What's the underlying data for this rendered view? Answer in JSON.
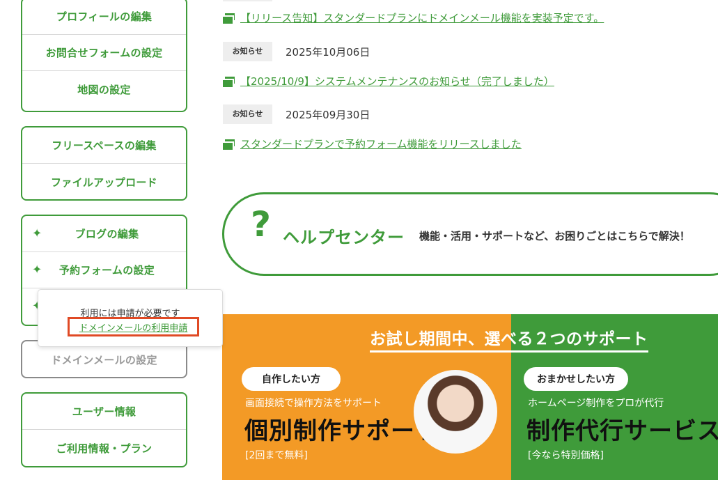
{
  "sidebar": {
    "group1": [
      "プロフィールの編集",
      "お問合せフォームの設定",
      "地図の設定"
    ],
    "group2": [
      "フリースペースの編集",
      "ファイルアップロード"
    ],
    "group3": [
      "ブログの編集",
      "予約フォームの設定",
      ""
    ],
    "spark": "✦",
    "domain_settings": "ドメインメールの設定",
    "group5": [
      "ユーザー情報",
      "ご利用情報・プラン"
    ]
  },
  "tooltip": {
    "text": "利用には申請が必要です",
    "link": "ドメインメールの利用申請"
  },
  "news": [
    {
      "title": "【リリース告知】スタンダードプランにドメインメール機能を実装予定です。"
    },
    {
      "badge": "お知らせ",
      "date": "2025年10月06日",
      "title": "【2025/10/9】システムメンテナンスのお知らせ（完了しました）"
    },
    {
      "badge": "お知らせ",
      "date": "2025年09月30日",
      "title": "スタンダードプランで予約フォーム機能をリリースしました"
    }
  ],
  "help": {
    "icon": "?",
    "title": "ヘルプセンター",
    "description": "機能・活用・サポートなど、お困りごとはこちらで解決！"
  },
  "support": {
    "heading": "お試し期間中、選べる２つのサポート",
    "left": {
      "pill": "自作したい方",
      "sub": "画面接続で操作方法をサポート",
      "title": "個別制作サポート",
      "note": "[2回まで無料]"
    },
    "right": {
      "pill": "おまかせしたい方",
      "sub": "ホームページ制作をプロが代行",
      "title": "制作代行サービス",
      "note": "[今なら特別価格]"
    }
  },
  "colors": {
    "accent": "#3f9b3a",
    "orange": "#f39a26",
    "highlight": "#e04a25"
  }
}
